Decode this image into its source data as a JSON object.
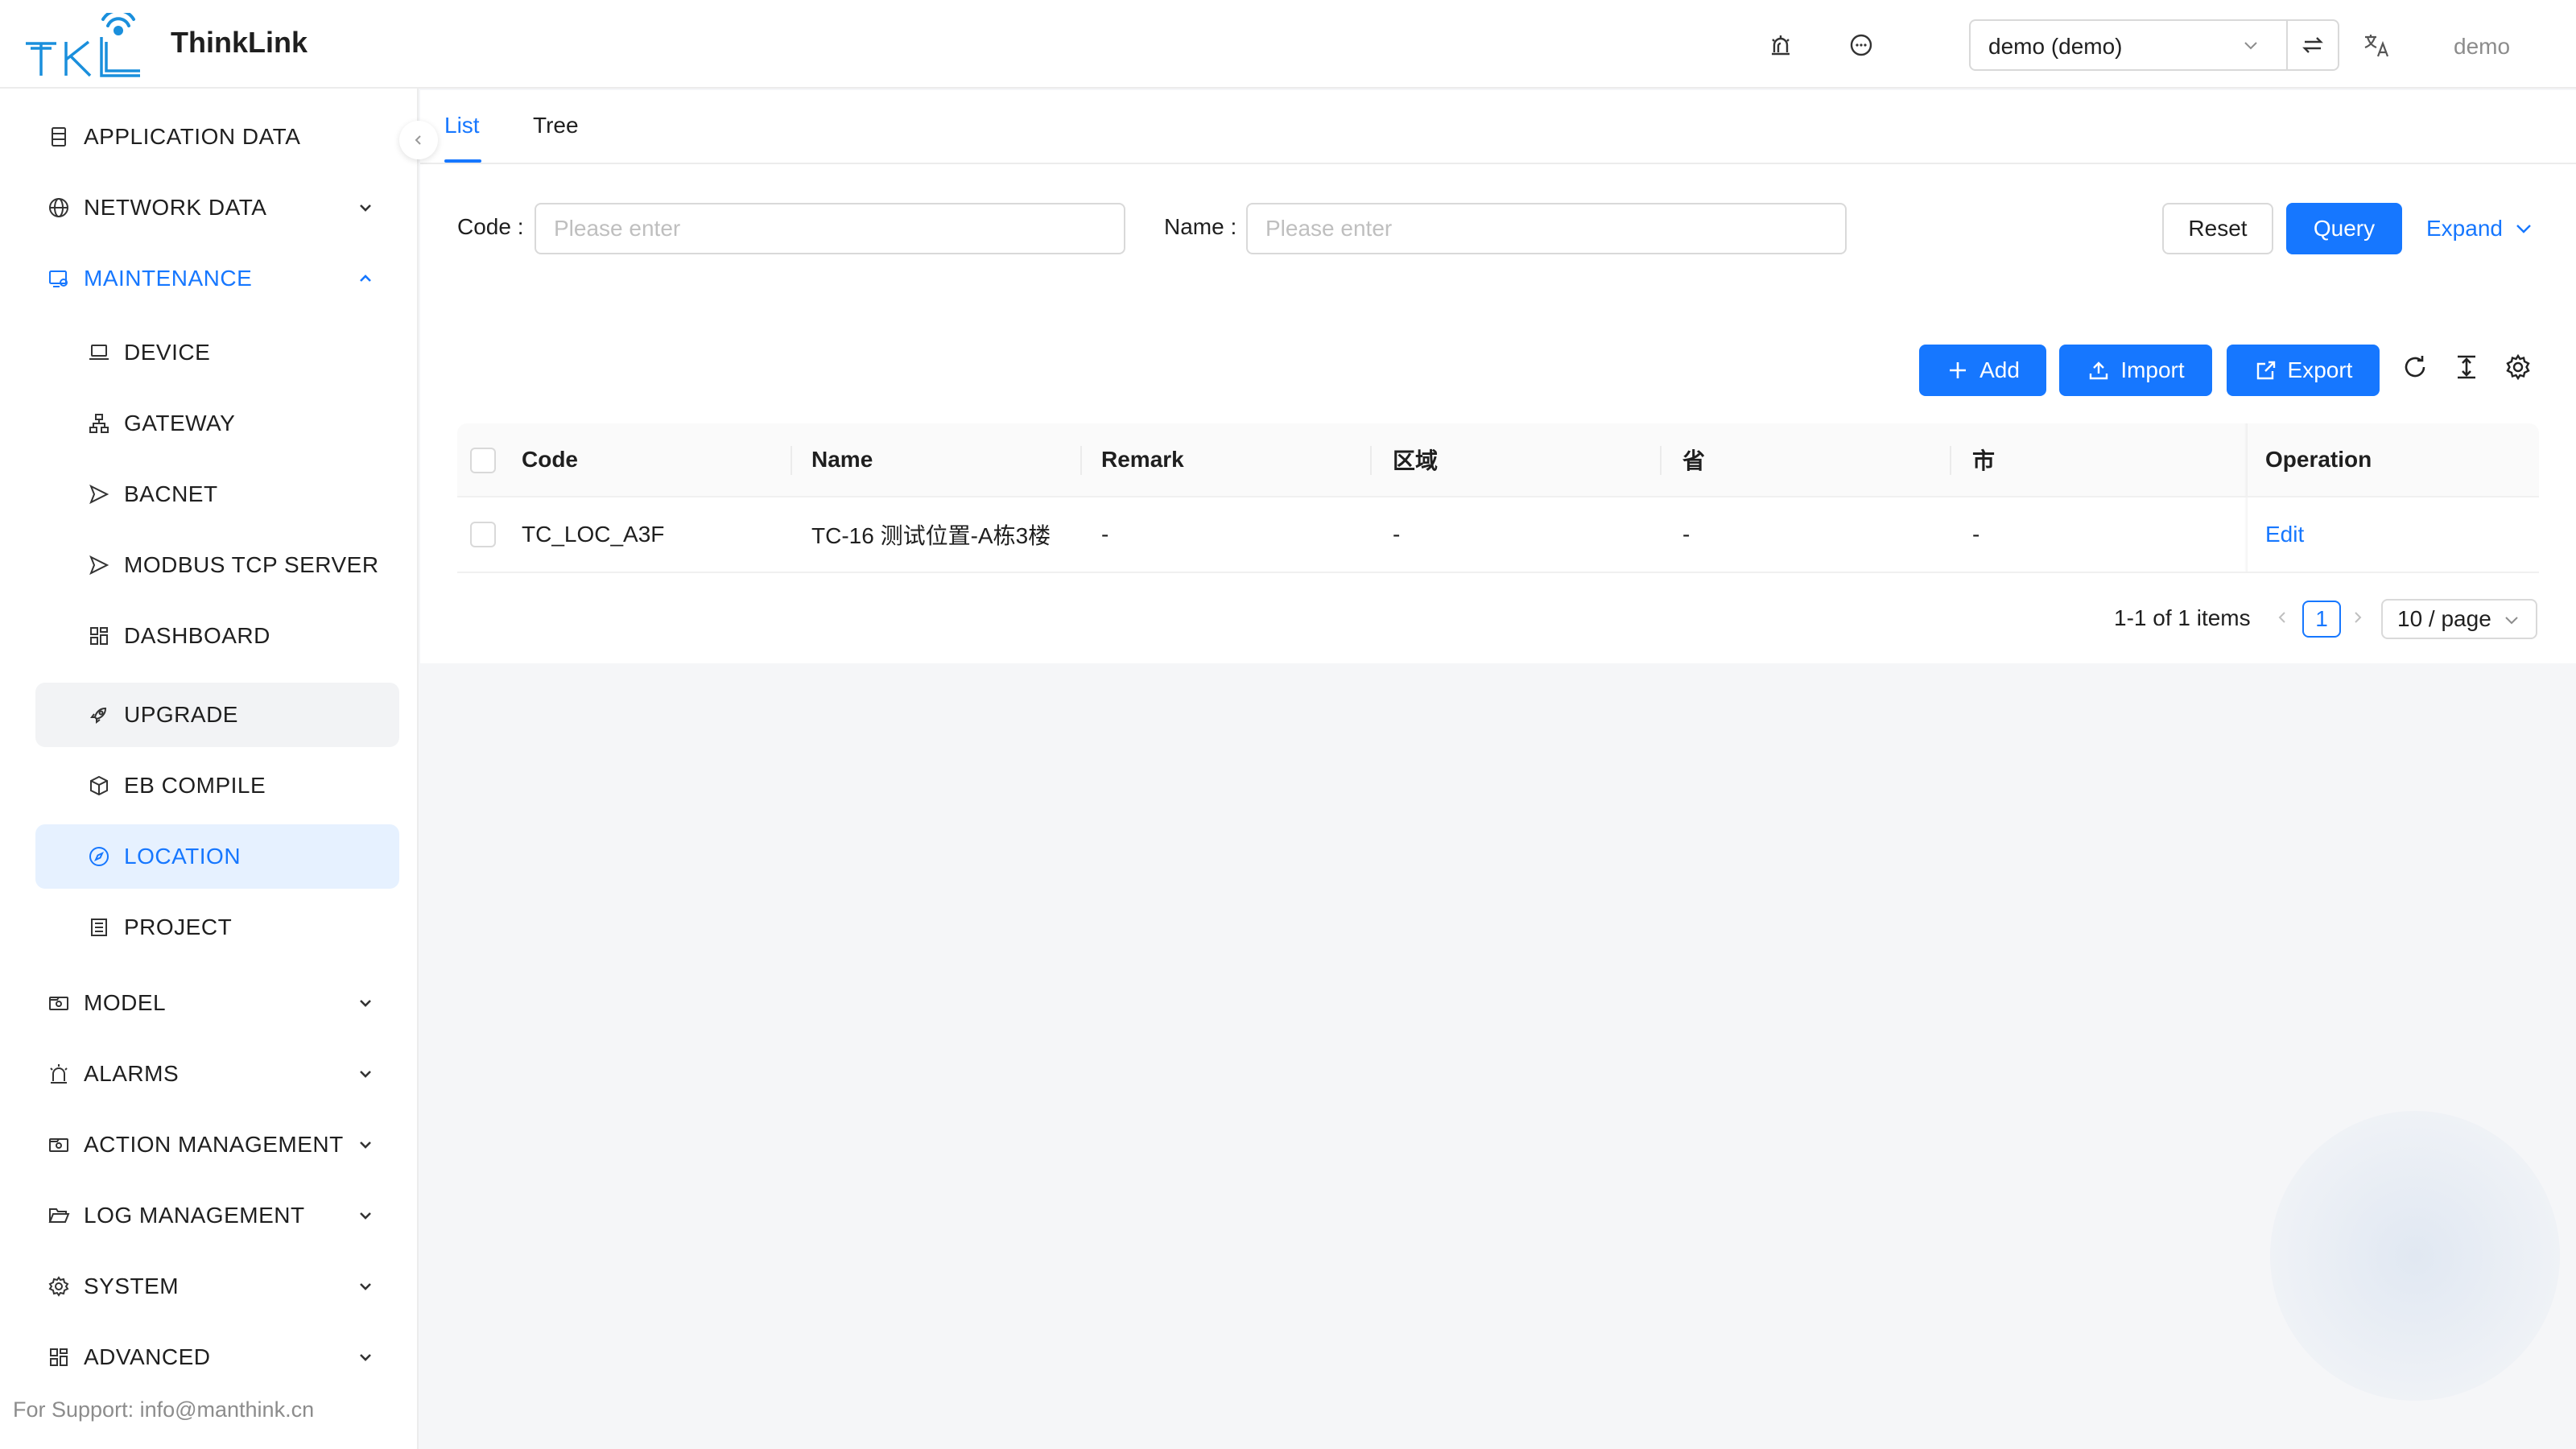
{
  "app": {
    "brand": "ThinkLink",
    "logo_text": "TKL"
  },
  "header": {
    "tenant_value": "demo (demo)",
    "user": "demo",
    "icons": [
      "alarm-icon",
      "message-icon",
      "swap-icon",
      "translate-icon"
    ]
  },
  "sidebar": {
    "items": [
      {
        "label": "APPLICATION DATA",
        "icon": "database-icon"
      },
      {
        "label": "NETWORK DATA",
        "icon": "globe-icon"
      },
      {
        "label": "MAINTENANCE",
        "icon": "maintenance-icon"
      },
      {
        "label": "DEVICE",
        "icon": "laptop-icon"
      },
      {
        "label": "GATEWAY",
        "icon": "cluster-icon"
      },
      {
        "label": "BACNET",
        "icon": "send-icon"
      },
      {
        "label": "MODBUS TCP SERVER",
        "icon": "send-icon"
      },
      {
        "label": "DASHBOARD",
        "icon": "dashboard-icon"
      },
      {
        "label": "UPGRADE",
        "icon": "rocket-icon"
      },
      {
        "label": "EB COMPILE",
        "icon": "cube-icon"
      },
      {
        "label": "LOCATION",
        "icon": "compass-icon"
      },
      {
        "label": "PROJECT",
        "icon": "list-icon"
      },
      {
        "label": "MODEL",
        "icon": "model-icon"
      },
      {
        "label": "ALARMS",
        "icon": "alarm-icon"
      },
      {
        "label": "ACTION MANAGEMENT",
        "icon": "action-icon"
      },
      {
        "label": "LOG MANAGEMENT",
        "icon": "folder-open-icon"
      },
      {
        "label": "SYSTEM",
        "icon": "gear-icon"
      },
      {
        "label": "ADVANCED",
        "icon": "appstore-icon"
      }
    ],
    "support": "For Support: info@manthink.cn"
  },
  "tabs": [
    {
      "label": "List"
    },
    {
      "label": "Tree"
    }
  ],
  "filters": {
    "code_label": "Code",
    "code_placeholder": "Please enter",
    "name_label": "Name",
    "name_placeholder": "Please enter",
    "reset": "Reset",
    "query": "Query",
    "expand": "Expand"
  },
  "toolbar": {
    "add": "Add",
    "import": "Import",
    "export": "Export"
  },
  "table": {
    "columns": [
      "Code",
      "Name",
      "Remark",
      "区域",
      "省",
      "市",
      "Operation"
    ],
    "rows": [
      {
        "code": "TC_LOC_A3F",
        "name": "TC-16 测试位置-A栋3楼",
        "remark": "-",
        "area": "-",
        "province": "-",
        "city": "-",
        "operation": "Edit"
      }
    ]
  },
  "pagination": {
    "summary": "1-1 of 1 items",
    "current": "1",
    "page_size": "10 / page"
  },
  "colors": {
    "primary": "#1677ff",
    "selected_bg": "#e6f1ff",
    "hover_bg": "#f2f3f5"
  }
}
